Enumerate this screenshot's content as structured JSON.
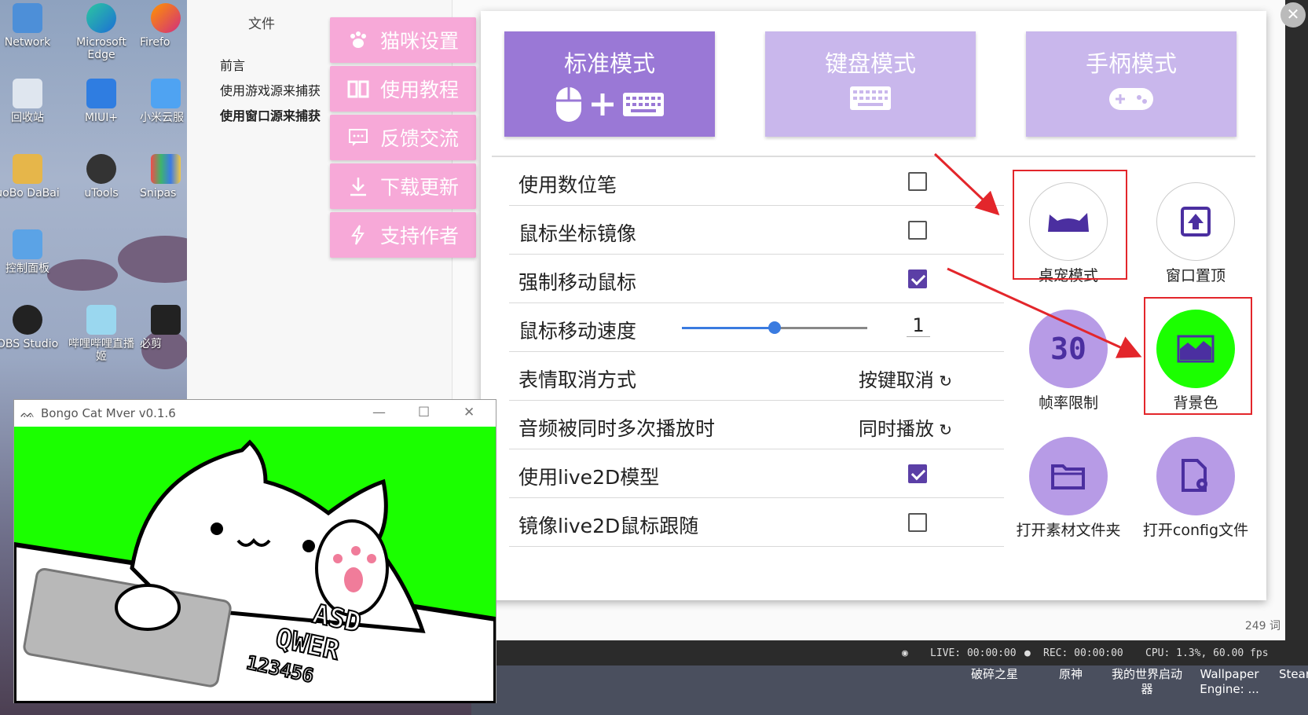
{
  "desktop": {
    "icons": [
      {
        "label": "Network"
      },
      {
        "label": "Microsoft Edge"
      },
      {
        "label": "Firefo"
      },
      {
        "label": "回收站"
      },
      {
        "label": "MIUI+"
      },
      {
        "label": "小米云服"
      },
      {
        "label": "uoBo DaBai"
      },
      {
        "label": "uTools"
      },
      {
        "label": "Snipas"
      },
      {
        "label": "控制面板"
      },
      {
        "label": "OBS Studio"
      },
      {
        "label": "哔哩哔哩直播姬"
      },
      {
        "label": "必剪"
      }
    ]
  },
  "explorer": {
    "file_label": "文件",
    "nav": [
      "前言",
      "使用游戏源来捕获",
      "使用窗口源来捕获"
    ],
    "count": "249 词"
  },
  "side_menu": {
    "items": [
      {
        "label": "猫咪设置",
        "icon": "paw-icon"
      },
      {
        "label": "使用教程",
        "icon": "book-icon"
      },
      {
        "label": "反馈交流",
        "icon": "chat-icon"
      },
      {
        "label": "下载更新",
        "icon": "download-icon"
      },
      {
        "label": "支持作者",
        "icon": "bolt-icon"
      }
    ]
  },
  "modes": [
    {
      "label": "标准模式",
      "active": true,
      "icons": [
        "mouse-icon",
        "plus-icon",
        "keyboard-icon"
      ]
    },
    {
      "label": "键盘模式",
      "active": false,
      "icons": [
        "keyboard-icon"
      ]
    },
    {
      "label": "手柄模式",
      "active": false,
      "icons": [
        "gamepad-icon"
      ]
    }
  ],
  "settings": {
    "digital_pen": {
      "label": "使用数位笔",
      "checked": false
    },
    "mouse_mirror": {
      "label": "鼠标坐标镜像",
      "checked": false
    },
    "force_move": {
      "label": "强制移动鼠标",
      "checked": true
    },
    "mouse_speed": {
      "label": "鼠标移动速度",
      "value": "1",
      "slider_fraction": 0.5
    },
    "emote_cancel": {
      "label": "表情取消方式",
      "value": "按键取消"
    },
    "audio_multi": {
      "label": "音频被同时多次播放时",
      "value": "同时播放"
    },
    "live2d": {
      "label": "使用live2D模型",
      "checked": true
    },
    "live2d_mirror": {
      "label": "镜像live2D鼠标跟随",
      "checked": false
    }
  },
  "actions": {
    "pet_mode": {
      "label": "桌宠模式",
      "icon": "cat-silhouette-icon"
    },
    "pin_top": {
      "label": "窗口置顶",
      "icon": "pin-top-icon"
    },
    "fps_limit": {
      "label": "帧率限制",
      "value": "30"
    },
    "bg_color": {
      "label": "背景色",
      "icon": "image-icon"
    },
    "open_assets": {
      "label": "打开素材文件夹",
      "icon": "folder-icon"
    },
    "open_config": {
      "label": "打开config文件",
      "icon": "config-file-icon"
    }
  },
  "bongo": {
    "title": "Bongo Cat Mver v0.1.6",
    "keys_row1": "ASD",
    "keys_row2": "QWER",
    "keys_row3": "123456"
  },
  "taskbar": {
    "live": "LIVE: 00:00:00",
    "rec": "REC: 00:00:00",
    "cpu": "CPU: 1.3%, 60.00 fps",
    "apps": [
      "破碎之星",
      "原神",
      "我的世界启动器",
      "Wallpaper Engine: ...",
      "Stear"
    ]
  },
  "colors": {
    "mode_active": "#9a78d6",
    "mode_inactive": "#c9b7ec",
    "side_menu": "#f7a9d8",
    "accent": "#5b3fa6",
    "green_screen": "#1bff00",
    "annotation_red": "#e3262b"
  }
}
